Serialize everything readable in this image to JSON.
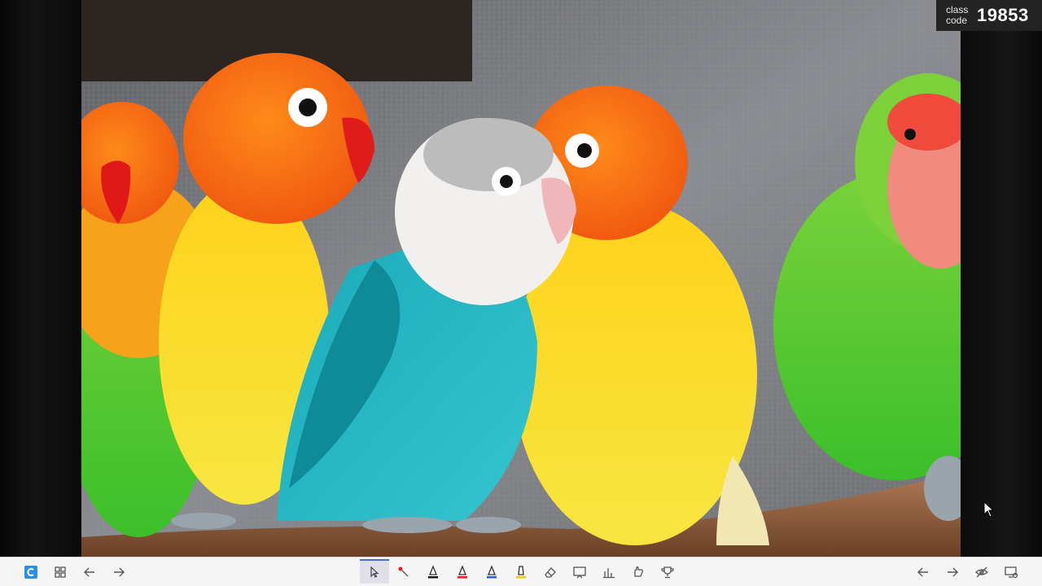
{
  "class_code": {
    "label": "class code",
    "value": "19853"
  },
  "stage_image": {
    "subject": "five colorful lovebirds perched on a branch"
  },
  "toolbar": {
    "left": [
      {
        "name": "app-logo-icon",
        "icon": "logo"
      },
      {
        "name": "grid-view-icon",
        "icon": "grid"
      },
      {
        "name": "back-arrow-icon",
        "icon": "arrow-left"
      },
      {
        "name": "forward-arrow-icon",
        "icon": "arrow-right"
      }
    ],
    "center": [
      {
        "name": "select-pointer-icon",
        "icon": "pointer",
        "active": true
      },
      {
        "name": "laser-pointer-icon",
        "icon": "laser"
      },
      {
        "name": "pen-black-icon",
        "icon": "pen",
        "color": "#1a1a1a"
      },
      {
        "name": "pen-red-icon",
        "icon": "pen",
        "color": "#e02020"
      },
      {
        "name": "pen-blue-icon",
        "icon": "pen",
        "color": "#2a5fd8"
      },
      {
        "name": "highlighter-yellow-icon",
        "icon": "pen",
        "color": "#e6d200"
      },
      {
        "name": "eraser-icon",
        "icon": "eraser"
      },
      {
        "name": "whiteboard-icon",
        "icon": "board"
      },
      {
        "name": "chart-icon",
        "icon": "chart"
      },
      {
        "name": "hand-raise-icon",
        "icon": "hand"
      },
      {
        "name": "trophy-icon",
        "icon": "trophy"
      }
    ],
    "right": [
      {
        "name": "prev-slide-icon",
        "icon": "arrow-left"
      },
      {
        "name": "next-slide-icon",
        "icon": "arrow-right"
      },
      {
        "name": "hide-view-icon",
        "icon": "eye-off"
      },
      {
        "name": "screen-settings-icon",
        "icon": "screen"
      }
    ]
  }
}
